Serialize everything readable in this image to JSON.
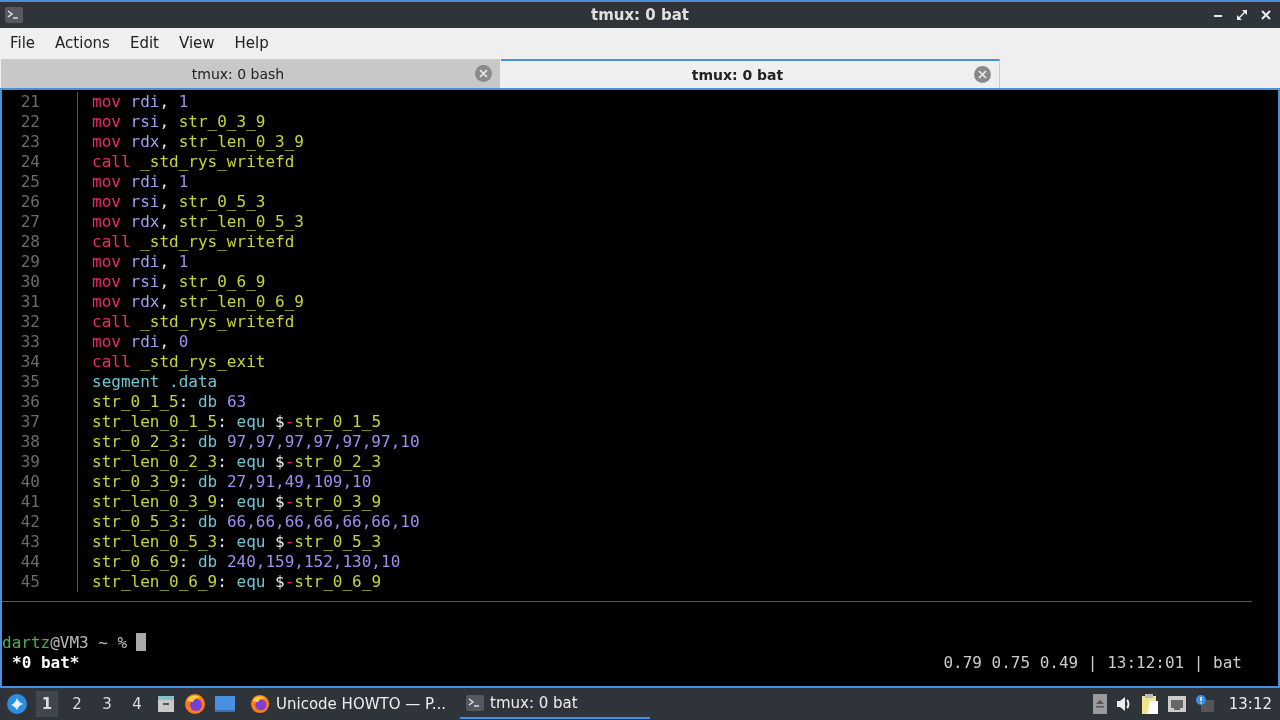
{
  "window": {
    "title": "tmux: 0 bat"
  },
  "menu": [
    "File",
    "Actions",
    "Edit",
    "View",
    "Help"
  ],
  "tabs": [
    {
      "label": "tmux: 0 bash",
      "selected": false
    },
    {
      "label": "tmux: 0 bat",
      "selected": true
    }
  ],
  "code": [
    {
      "number": "21",
      "tokens": [
        {
          "kind": "keyword",
          "text": "mov "
        },
        {
          "kind": "register",
          "text": "rdi"
        },
        {
          "kind": "punct",
          "text": ", "
        },
        {
          "kind": "number",
          "text": "1"
        }
      ]
    },
    {
      "number": "22",
      "tokens": [
        {
          "kind": "keyword",
          "text": "mov "
        },
        {
          "kind": "register",
          "text": "rsi"
        },
        {
          "kind": "punct",
          "text": ", "
        },
        {
          "kind": "label",
          "text": "str_0_3_9"
        }
      ]
    },
    {
      "number": "23",
      "tokens": [
        {
          "kind": "keyword",
          "text": "mov "
        },
        {
          "kind": "register",
          "text": "rdx"
        },
        {
          "kind": "punct",
          "text": ", "
        },
        {
          "kind": "label",
          "text": "str_len_0_3_9"
        }
      ]
    },
    {
      "number": "24",
      "tokens": [
        {
          "kind": "keyword",
          "text": "call "
        },
        {
          "kind": "label",
          "text": "_std_rys_writefd"
        }
      ]
    },
    {
      "number": "25",
      "tokens": [
        {
          "kind": "keyword",
          "text": "mov "
        },
        {
          "kind": "register",
          "text": "rdi"
        },
        {
          "kind": "punct",
          "text": ", "
        },
        {
          "kind": "number",
          "text": "1"
        }
      ]
    },
    {
      "number": "26",
      "tokens": [
        {
          "kind": "keyword",
          "text": "mov "
        },
        {
          "kind": "register",
          "text": "rsi"
        },
        {
          "kind": "punct",
          "text": ", "
        },
        {
          "kind": "label",
          "text": "str_0_5_3"
        }
      ]
    },
    {
      "number": "27",
      "tokens": [
        {
          "kind": "keyword",
          "text": "mov "
        },
        {
          "kind": "register",
          "text": "rdx"
        },
        {
          "kind": "punct",
          "text": ", "
        },
        {
          "kind": "label",
          "text": "str_len_0_5_3"
        }
      ]
    },
    {
      "number": "28",
      "tokens": [
        {
          "kind": "keyword",
          "text": "call "
        },
        {
          "kind": "label",
          "text": "_std_rys_writefd"
        }
      ]
    },
    {
      "number": "29",
      "tokens": [
        {
          "kind": "keyword",
          "text": "mov "
        },
        {
          "kind": "register",
          "text": "rdi"
        },
        {
          "kind": "punct",
          "text": ", "
        },
        {
          "kind": "number",
          "text": "1"
        }
      ]
    },
    {
      "number": "30",
      "tokens": [
        {
          "kind": "keyword",
          "text": "mov "
        },
        {
          "kind": "register",
          "text": "rsi"
        },
        {
          "kind": "punct",
          "text": ", "
        },
        {
          "kind": "label",
          "text": "str_0_6_9"
        }
      ]
    },
    {
      "number": "31",
      "tokens": [
        {
          "kind": "keyword",
          "text": "mov "
        },
        {
          "kind": "register",
          "text": "rdx"
        },
        {
          "kind": "punct",
          "text": ", "
        },
        {
          "kind": "label",
          "text": "str_len_0_6_9"
        }
      ]
    },
    {
      "number": "32",
      "tokens": [
        {
          "kind": "keyword",
          "text": "call "
        },
        {
          "kind": "label",
          "text": "_std_rys_writefd"
        }
      ]
    },
    {
      "number": "33",
      "tokens": [
        {
          "kind": "keyword",
          "text": "mov "
        },
        {
          "kind": "register",
          "text": "rdi"
        },
        {
          "kind": "punct",
          "text": ", "
        },
        {
          "kind": "number",
          "text": "0"
        }
      ]
    },
    {
      "number": "34",
      "tokens": [
        {
          "kind": "keyword",
          "text": "call "
        },
        {
          "kind": "label",
          "text": "_std_rys_exit"
        }
      ]
    },
    {
      "number": "35",
      "tokens": [
        {
          "kind": "directive",
          "text": "segment .data"
        }
      ]
    },
    {
      "number": "36",
      "tokens": [
        {
          "kind": "label",
          "text": "str_0_1_5"
        },
        {
          "kind": "punct",
          "text": ": "
        },
        {
          "kind": "directive",
          "text": "db "
        },
        {
          "kind": "number",
          "text": "63"
        }
      ]
    },
    {
      "number": "37",
      "tokens": [
        {
          "kind": "label",
          "text": "str_len_0_1_5"
        },
        {
          "kind": "punct",
          "text": ": "
        },
        {
          "kind": "directive",
          "text": "equ "
        },
        {
          "kind": "punct",
          "text": "$"
        },
        {
          "kind": "operator",
          "text": "-"
        },
        {
          "kind": "label",
          "text": "str_0_1_5"
        }
      ]
    },
    {
      "number": "38",
      "tokens": [
        {
          "kind": "label",
          "text": "str_0_2_3"
        },
        {
          "kind": "punct",
          "text": ": "
        },
        {
          "kind": "directive",
          "text": "db "
        },
        {
          "kind": "number",
          "text": "97,97,97,97,97,97,10"
        }
      ]
    },
    {
      "number": "39",
      "tokens": [
        {
          "kind": "label",
          "text": "str_len_0_2_3"
        },
        {
          "kind": "punct",
          "text": ": "
        },
        {
          "kind": "directive",
          "text": "equ "
        },
        {
          "kind": "punct",
          "text": "$"
        },
        {
          "kind": "operator",
          "text": "-"
        },
        {
          "kind": "label",
          "text": "str_0_2_3"
        }
      ]
    },
    {
      "number": "40",
      "tokens": [
        {
          "kind": "label",
          "text": "str_0_3_9"
        },
        {
          "kind": "punct",
          "text": ": "
        },
        {
          "kind": "directive",
          "text": "db "
        },
        {
          "kind": "number",
          "text": "27,91,49,109,10"
        }
      ]
    },
    {
      "number": "41",
      "tokens": [
        {
          "kind": "label",
          "text": "str_len_0_3_9"
        },
        {
          "kind": "punct",
          "text": ": "
        },
        {
          "kind": "directive",
          "text": "equ "
        },
        {
          "kind": "punct",
          "text": "$"
        },
        {
          "kind": "operator",
          "text": "-"
        },
        {
          "kind": "label",
          "text": "str_0_3_9"
        }
      ]
    },
    {
      "number": "42",
      "tokens": [
        {
          "kind": "label",
          "text": "str_0_5_3"
        },
        {
          "kind": "punct",
          "text": ": "
        },
        {
          "kind": "directive",
          "text": "db "
        },
        {
          "kind": "number",
          "text": "66,66,66,66,66,66,10"
        }
      ]
    },
    {
      "number": "43",
      "tokens": [
        {
          "kind": "label",
          "text": "str_len_0_5_3"
        },
        {
          "kind": "punct",
          "text": ": "
        },
        {
          "kind": "directive",
          "text": "equ "
        },
        {
          "kind": "punct",
          "text": "$"
        },
        {
          "kind": "operator",
          "text": "-"
        },
        {
          "kind": "label",
          "text": "str_0_5_3"
        }
      ]
    },
    {
      "number": "44",
      "tokens": [
        {
          "kind": "label",
          "text": "str_0_6_9"
        },
        {
          "kind": "punct",
          "text": ": "
        },
        {
          "kind": "directive",
          "text": "db "
        },
        {
          "kind": "number",
          "text": "240,159,152,130,10"
        }
      ]
    },
    {
      "number": "45",
      "tokens": [
        {
          "kind": "label",
          "text": "str_len_0_6_9"
        },
        {
          "kind": "punct",
          "text": ": "
        },
        {
          "kind": "directive",
          "text": "equ "
        },
        {
          "kind": "punct",
          "text": "$"
        },
        {
          "kind": "operator",
          "text": "-"
        },
        {
          "kind": "label",
          "text": "str_0_6_9"
        }
      ]
    }
  ],
  "prompt": {
    "user": "dartz",
    "rest": "@VM3 ~ %"
  },
  "status_bar": {
    "session": "*0 bat*",
    "right": "0.79 0.75 0.49 | 13:12:01 | bat"
  },
  "taskbar": {
    "workspaces": [
      {
        "label": "1",
        "selected": true
      },
      {
        "label": "2",
        "selected": false
      },
      {
        "label": "3",
        "selected": false
      },
      {
        "label": "4",
        "selected": false
      }
    ],
    "tasks": [
      {
        "kind": "browser",
        "label": "Unicode HOWTO — P...",
        "selected": false
      },
      {
        "kind": "terminal",
        "label": "tmux: 0 bat",
        "selected": true
      }
    ],
    "clock": "13:12"
  }
}
